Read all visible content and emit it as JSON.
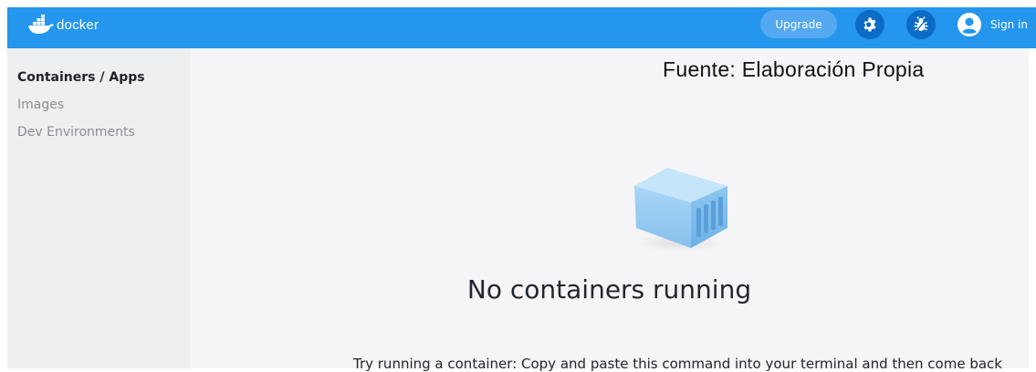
{
  "app": {
    "logo_text": "docker"
  },
  "header": {
    "upgrade_label": "Upgrade",
    "settings_icon": "gear-icon",
    "troubleshoot_icon": "bug-icon",
    "user_icon": "user-circle-icon",
    "signin_label": "Sign in",
    "accent_color": "#2496ED"
  },
  "sidebar": {
    "items": [
      {
        "label": "Containers / Apps",
        "active": true
      },
      {
        "label": "Images",
        "active": false
      },
      {
        "label": "Dev Environments",
        "active": false
      }
    ]
  },
  "main": {
    "credit": "Fuente: Elaboración Propia",
    "empty_icon": "container-cube-icon",
    "empty_title": "No containers running",
    "hint": "Try running a container: Copy and paste this command into your terminal and then come back"
  }
}
